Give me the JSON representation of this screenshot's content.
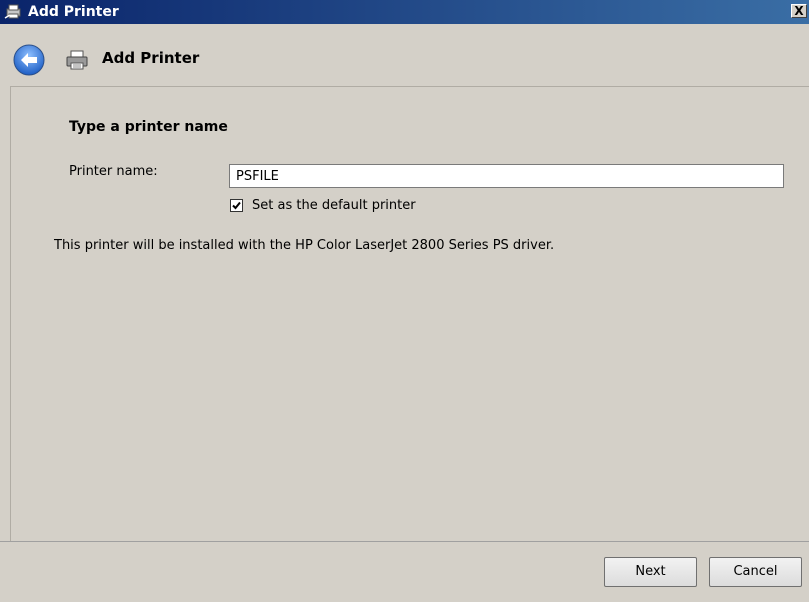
{
  "window": {
    "title": "Add Printer",
    "close_label": "X"
  },
  "nav": {
    "title": "Add Printer",
    "back_icon": "back-arrow-icon",
    "printer_icon": "printer-icon"
  },
  "main": {
    "heading": "Type a printer name",
    "printer_name_label": "Printer name:",
    "printer_name_value": "PSFILE",
    "default_checkbox_label": "Set as the default printer",
    "default_checked": true,
    "driver_info": "This printer will be installed with the HP Color LaserJet 2800 Series PS driver."
  },
  "footer": {
    "next_label": "Next",
    "cancel_label": "Cancel"
  },
  "colors": {
    "titlebar": "#0a246a",
    "background": "#d4d0c8",
    "back_button": "#2f6fcf"
  }
}
